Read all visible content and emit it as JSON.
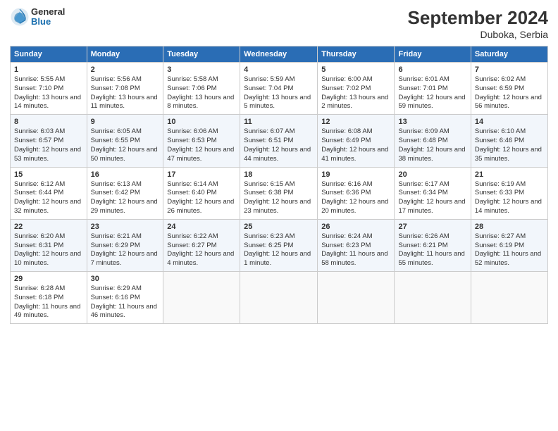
{
  "header": {
    "logo_general": "General",
    "logo_blue": "Blue",
    "month_title": "September 2024",
    "location": "Duboka, Serbia"
  },
  "days_of_week": [
    "Sunday",
    "Monday",
    "Tuesday",
    "Wednesday",
    "Thursday",
    "Friday",
    "Saturday"
  ],
  "weeks": [
    [
      {
        "day": "1",
        "sunrise": "Sunrise: 5:55 AM",
        "sunset": "Sunset: 7:10 PM",
        "daylight": "Daylight: 13 hours and 14 minutes."
      },
      {
        "day": "2",
        "sunrise": "Sunrise: 5:56 AM",
        "sunset": "Sunset: 7:08 PM",
        "daylight": "Daylight: 13 hours and 11 minutes."
      },
      {
        "day": "3",
        "sunrise": "Sunrise: 5:58 AM",
        "sunset": "Sunset: 7:06 PM",
        "daylight": "Daylight: 13 hours and 8 minutes."
      },
      {
        "day": "4",
        "sunrise": "Sunrise: 5:59 AM",
        "sunset": "Sunset: 7:04 PM",
        "daylight": "Daylight: 13 hours and 5 minutes."
      },
      {
        "day": "5",
        "sunrise": "Sunrise: 6:00 AM",
        "sunset": "Sunset: 7:02 PM",
        "daylight": "Daylight: 13 hours and 2 minutes."
      },
      {
        "day": "6",
        "sunrise": "Sunrise: 6:01 AM",
        "sunset": "Sunset: 7:01 PM",
        "daylight": "Daylight: 12 hours and 59 minutes."
      },
      {
        "day": "7",
        "sunrise": "Sunrise: 6:02 AM",
        "sunset": "Sunset: 6:59 PM",
        "daylight": "Daylight: 12 hours and 56 minutes."
      }
    ],
    [
      {
        "day": "8",
        "sunrise": "Sunrise: 6:03 AM",
        "sunset": "Sunset: 6:57 PM",
        "daylight": "Daylight: 12 hours and 53 minutes."
      },
      {
        "day": "9",
        "sunrise": "Sunrise: 6:05 AM",
        "sunset": "Sunset: 6:55 PM",
        "daylight": "Daylight: 12 hours and 50 minutes."
      },
      {
        "day": "10",
        "sunrise": "Sunrise: 6:06 AM",
        "sunset": "Sunset: 6:53 PM",
        "daylight": "Daylight: 12 hours and 47 minutes."
      },
      {
        "day": "11",
        "sunrise": "Sunrise: 6:07 AM",
        "sunset": "Sunset: 6:51 PM",
        "daylight": "Daylight: 12 hours and 44 minutes."
      },
      {
        "day": "12",
        "sunrise": "Sunrise: 6:08 AM",
        "sunset": "Sunset: 6:49 PM",
        "daylight": "Daylight: 12 hours and 41 minutes."
      },
      {
        "day": "13",
        "sunrise": "Sunrise: 6:09 AM",
        "sunset": "Sunset: 6:48 PM",
        "daylight": "Daylight: 12 hours and 38 minutes."
      },
      {
        "day": "14",
        "sunrise": "Sunrise: 6:10 AM",
        "sunset": "Sunset: 6:46 PM",
        "daylight": "Daylight: 12 hours and 35 minutes."
      }
    ],
    [
      {
        "day": "15",
        "sunrise": "Sunrise: 6:12 AM",
        "sunset": "Sunset: 6:44 PM",
        "daylight": "Daylight: 12 hours and 32 minutes."
      },
      {
        "day": "16",
        "sunrise": "Sunrise: 6:13 AM",
        "sunset": "Sunset: 6:42 PM",
        "daylight": "Daylight: 12 hours and 29 minutes."
      },
      {
        "day": "17",
        "sunrise": "Sunrise: 6:14 AM",
        "sunset": "Sunset: 6:40 PM",
        "daylight": "Daylight: 12 hours and 26 minutes."
      },
      {
        "day": "18",
        "sunrise": "Sunrise: 6:15 AM",
        "sunset": "Sunset: 6:38 PM",
        "daylight": "Daylight: 12 hours and 23 minutes."
      },
      {
        "day": "19",
        "sunrise": "Sunrise: 6:16 AM",
        "sunset": "Sunset: 6:36 PM",
        "daylight": "Daylight: 12 hours and 20 minutes."
      },
      {
        "day": "20",
        "sunrise": "Sunrise: 6:17 AM",
        "sunset": "Sunset: 6:34 PM",
        "daylight": "Daylight: 12 hours and 17 minutes."
      },
      {
        "day": "21",
        "sunrise": "Sunrise: 6:19 AM",
        "sunset": "Sunset: 6:33 PM",
        "daylight": "Daylight: 12 hours and 14 minutes."
      }
    ],
    [
      {
        "day": "22",
        "sunrise": "Sunrise: 6:20 AM",
        "sunset": "Sunset: 6:31 PM",
        "daylight": "Daylight: 12 hours and 10 minutes."
      },
      {
        "day": "23",
        "sunrise": "Sunrise: 6:21 AM",
        "sunset": "Sunset: 6:29 PM",
        "daylight": "Daylight: 12 hours and 7 minutes."
      },
      {
        "day": "24",
        "sunrise": "Sunrise: 6:22 AM",
        "sunset": "Sunset: 6:27 PM",
        "daylight": "Daylight: 12 hours and 4 minutes."
      },
      {
        "day": "25",
        "sunrise": "Sunrise: 6:23 AM",
        "sunset": "Sunset: 6:25 PM",
        "daylight": "Daylight: 12 hours and 1 minute."
      },
      {
        "day": "26",
        "sunrise": "Sunrise: 6:24 AM",
        "sunset": "Sunset: 6:23 PM",
        "daylight": "Daylight: 11 hours and 58 minutes."
      },
      {
        "day": "27",
        "sunrise": "Sunrise: 6:26 AM",
        "sunset": "Sunset: 6:21 PM",
        "daylight": "Daylight: 11 hours and 55 minutes."
      },
      {
        "day": "28",
        "sunrise": "Sunrise: 6:27 AM",
        "sunset": "Sunset: 6:19 PM",
        "daylight": "Daylight: 11 hours and 52 minutes."
      }
    ],
    [
      {
        "day": "29",
        "sunrise": "Sunrise: 6:28 AM",
        "sunset": "Sunset: 6:18 PM",
        "daylight": "Daylight: 11 hours and 49 minutes."
      },
      {
        "day": "30",
        "sunrise": "Sunrise: 6:29 AM",
        "sunset": "Sunset: 6:16 PM",
        "daylight": "Daylight: 11 hours and 46 minutes."
      },
      null,
      null,
      null,
      null,
      null
    ]
  ]
}
